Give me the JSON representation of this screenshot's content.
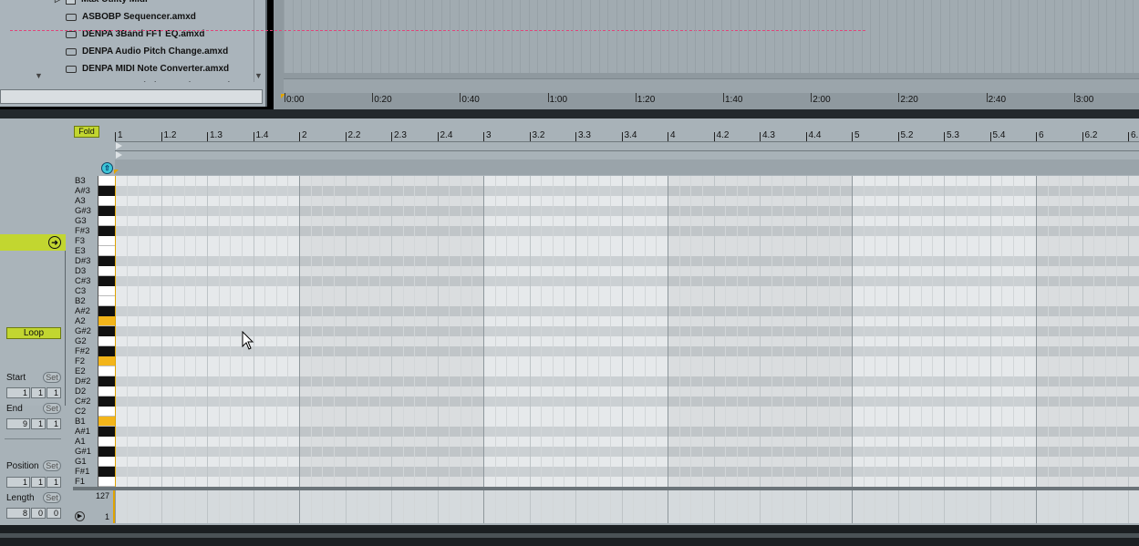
{
  "browser": {
    "items": [
      {
        "label": "Max Utility Midi",
        "kind": "folder"
      },
      {
        "label": "ASBOBP Sequencer.amxd",
        "kind": "device"
      },
      {
        "label": "DENPA 3Band FFT EQ.amxd",
        "kind": "device"
      },
      {
        "label": "DENPA Audio Pitch Change.amxd",
        "kind": "device"
      },
      {
        "label": "DENPA MIDI Note Converter.amxd",
        "kind": "device"
      },
      {
        "label": "DENPA MIDI Pitch Quantizer.amxd",
        "kind": "device"
      }
    ],
    "scroll_down_icon": "triangle-down-icon"
  },
  "arrangement": {
    "time_labels": [
      "0:00",
      "0:20",
      "0:40",
      "1:00",
      "1:20",
      "1:40",
      "2:00",
      "2:20",
      "2:40",
      "3:00"
    ],
    "dashed_line_color": "#e0457a"
  },
  "clip": {
    "fold_label": "Fold",
    "ruler_labels": [
      "1",
      "1.2",
      "1.3",
      "1.4",
      "2",
      "2.2",
      "2.3",
      "2.4",
      "3",
      "3.2",
      "3.3",
      "3.4",
      "4",
      "4.2",
      "4.3",
      "4.4",
      "5",
      "5.2",
      "5.3",
      "5.4",
      "6",
      "6.2",
      "6."
    ],
    "notes": [
      "B3",
      "A#3",
      "A3",
      "G#3",
      "G3",
      "F#3",
      "F3",
      "E3",
      "D#3",
      "D3",
      "C#3",
      "C3",
      "B2",
      "A#2",
      "A2",
      "G#2",
      "G2",
      "F#2",
      "F2",
      "E2",
      "D#2",
      "D2",
      "C#2",
      "C2",
      "B1",
      "A#1",
      "A1",
      "G#1",
      "G1",
      "F#1",
      "F1"
    ],
    "highlighted_notes": [
      "A2",
      "F2",
      "B1"
    ],
    "highlight_color": "#f3b51a",
    "velocity": {
      "max": "127",
      "min": "1"
    }
  },
  "clipbox": {
    "start_label": "Start",
    "set_label": "Set",
    "start": [
      "1",
      "1",
      "1"
    ],
    "end_label": "End",
    "end": [
      "9",
      "1",
      "1"
    ],
    "loop_label": "Loop",
    "position_label": "Position",
    "position": [
      "1",
      "1",
      "1"
    ],
    "length_label": "Length",
    "length": [
      "8",
      "0",
      "0"
    ],
    "accent_color": "#c2d630"
  }
}
